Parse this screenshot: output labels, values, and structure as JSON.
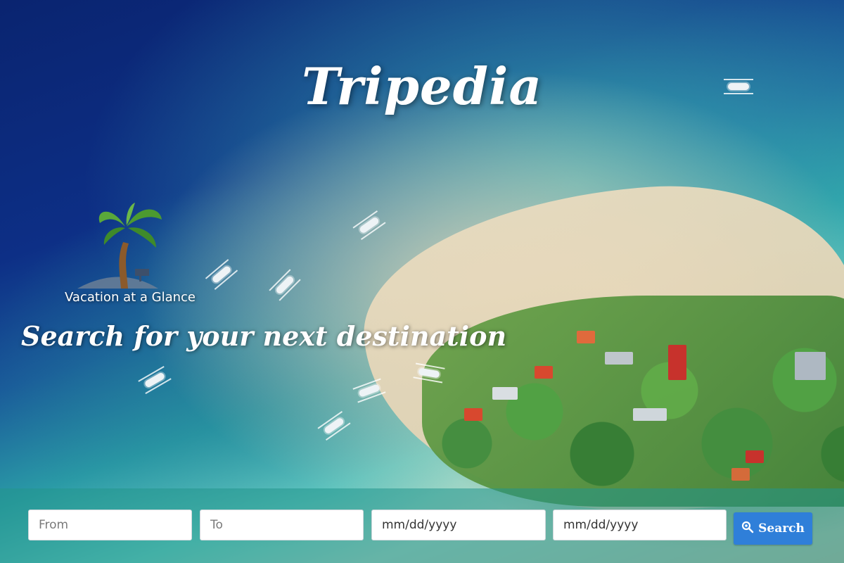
{
  "header": {
    "title": "Tripedia",
    "tagline": "Search for your next destination"
  },
  "logo": {
    "text": "Vacation at a Glance"
  },
  "search": {
    "from_placeholder": "From",
    "to_placeholder": "To",
    "depart_date": "mm/dd/yyyy",
    "return_date": "mm/dd/yyyy",
    "button_label": "Search",
    "button_icon": "search-icon"
  },
  "colors": {
    "button": "#2f7fd9",
    "search_bar": "rgba(34,150,140,0.55)",
    "text": "#ffffff"
  }
}
